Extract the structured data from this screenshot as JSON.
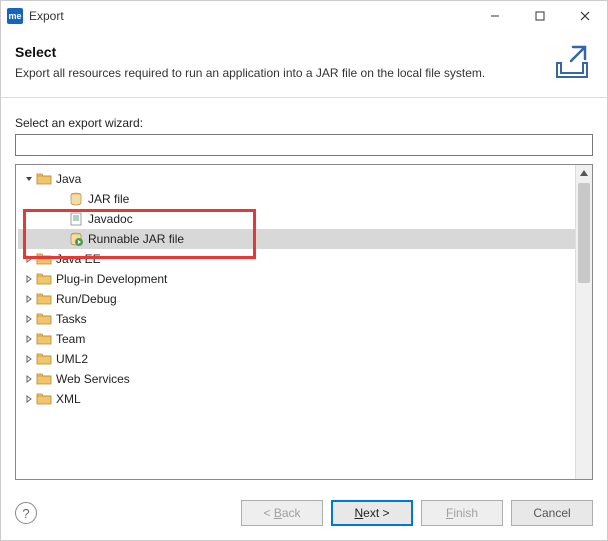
{
  "window": {
    "title": "Export",
    "app_badge": "me"
  },
  "header": {
    "title": "Select",
    "description": "Export all resources required to run an application into a JAR file on the local file system."
  },
  "main": {
    "prompt": "Select an export wizard:",
    "filter_value": ""
  },
  "tree": {
    "items": [
      {
        "label": "Java",
        "type": "folder-open",
        "expanded": true,
        "level": 1
      },
      {
        "label": "JAR file",
        "type": "jar",
        "level": 2
      },
      {
        "label": "Javadoc",
        "type": "doc",
        "level": 2
      },
      {
        "label": "Runnable JAR file",
        "type": "runjar",
        "level": 2,
        "selected": true
      },
      {
        "label": "Java EE",
        "type": "folder",
        "expanded": false,
        "level": 1
      },
      {
        "label": "Plug-in Development",
        "type": "folder",
        "expanded": false,
        "level": 1
      },
      {
        "label": "Run/Debug",
        "type": "folder",
        "expanded": false,
        "level": 1
      },
      {
        "label": "Tasks",
        "type": "folder",
        "expanded": false,
        "level": 1
      },
      {
        "label": "Team",
        "type": "folder",
        "expanded": false,
        "level": 1
      },
      {
        "label": "UML2",
        "type": "folder",
        "expanded": false,
        "level": 1
      },
      {
        "label": "Web Services",
        "type": "folder",
        "expanded": false,
        "level": 1
      },
      {
        "label": "XML",
        "type": "folder",
        "expanded": false,
        "level": 1
      }
    ]
  },
  "buttons": {
    "back": "< Back",
    "finish": "Finish",
    "cancel": "Cancel"
  }
}
